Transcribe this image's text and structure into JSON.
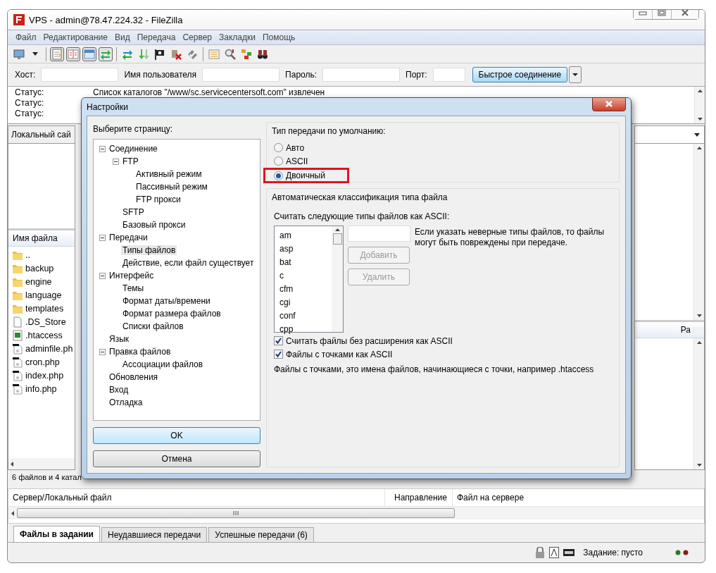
{
  "window": {
    "title": "VPS - admin@78.47.224.32 - FileZilla"
  },
  "menu": [
    "Файл",
    "Редактирование",
    "Вид",
    "Передача",
    "Сервер",
    "Закладки",
    "Помощь"
  ],
  "toolbar": [
    {
      "kind": "monitor"
    },
    {
      "kind": "caret"
    },
    {
      "kind": "sep"
    },
    {
      "kind": "notepad",
      "on": true
    },
    {
      "kind": "panel",
      "on": true
    },
    {
      "kind": "window",
      "on": true
    },
    {
      "kind": "arrows",
      "on": true
    },
    {
      "kind": "sep"
    },
    {
      "kind": "sync"
    },
    {
      "kind": "down"
    },
    {
      "kind": "flag"
    },
    {
      "kind": "cross"
    },
    {
      "kind": "check"
    },
    {
      "kind": "sep"
    },
    {
      "kind": "list"
    },
    {
      "kind": "magnifier"
    },
    {
      "kind": "tree"
    },
    {
      "kind": "binoculars"
    }
  ],
  "quickconnect": {
    "host_label": "Хост:",
    "user_label": "Имя пользователя",
    "password_label": "Пароль:",
    "port_label": "Порт:",
    "button": "Быстрое соединение"
  },
  "log": [
    {
      "label": "Статус:",
      "message": "Список каталогов \"/www/sc.servicecentersoft.com\" извлечен"
    },
    {
      "label": "Статус:"
    },
    {
      "label": "Статус:"
    }
  ],
  "local_site": {
    "label": "Локальный сай"
  },
  "local_files": {
    "column": "Имя файла",
    "rows": [
      {
        "name": "..",
        "kind": "folder"
      },
      {
        "name": "backup",
        "kind": "folder"
      },
      {
        "name": "engine",
        "kind": "folder"
      },
      {
        "name": "language",
        "kind": "folder"
      },
      {
        "name": "templates",
        "kind": "folder"
      },
      {
        "name": ".DS_Store",
        "kind": "file"
      },
      {
        "name": ".htaccess",
        "kind": "config"
      },
      {
        "name": "adminfile.ph",
        "kind": "script"
      },
      {
        "name": "cron.php",
        "kind": "script"
      },
      {
        "name": "index.php",
        "kind": "script"
      },
      {
        "name": "info.php",
        "kind": "script"
      }
    ]
  },
  "remote_files": {
    "column_1": "Ра"
  },
  "local_status": "6 файлов и 4 катал",
  "queue": {
    "columns": [
      "Сервер/Локальный файл",
      "Направление",
      "Файл на сервере"
    ]
  },
  "tabs": [
    {
      "label": "Файлы в задании",
      "selected": true
    },
    {
      "label": "Неудавшиеся передачи",
      "selected": false
    },
    {
      "label": "Успешные передачи (6)",
      "selected": false
    }
  ],
  "status_bar": {
    "queue": "Задание: пусто"
  },
  "dialog": {
    "title": "Настройки",
    "page_label": "Выберите страницу:",
    "tree": [
      {
        "label": "Соединение",
        "expanded": true,
        "selected": false,
        "children": [
          {
            "label": "FTP",
            "expanded": true,
            "selected": false,
            "children": [
              {
                "label": "Активный режим",
                "selected": false
              },
              {
                "label": "Пассивный режим",
                "selected": false
              },
              {
                "label": "FTP прокси",
                "selected": false
              }
            ]
          },
          {
            "label": "SFTP",
            "selected": false
          },
          {
            "label": "Базовый прокси",
            "selected": false
          }
        ]
      },
      {
        "label": "Передачи",
        "expanded": true,
        "selected": false,
        "children": [
          {
            "label": "Типы файлов",
            "selected": true
          },
          {
            "label": "Действие, если файл существует",
            "selected": false
          }
        ]
      },
      {
        "label": "Интерфейс",
        "expanded": true,
        "selected": false,
        "children": [
          {
            "label": "Темы",
            "selected": false
          },
          {
            "label": "Формат даты/времени",
            "selected": false
          },
          {
            "label": "Формат размера файлов",
            "selected": false
          },
          {
            "label": "Списки файлов",
            "selected": false
          }
        ]
      },
      {
        "label": "Язык",
        "selected": false
      },
      {
        "label": "Правка файлов",
        "expanded": true,
        "selected": false,
        "children": [
          {
            "label": "Ассоциации файлов",
            "selected": false
          }
        ]
      },
      {
        "label": "Обновления",
        "selected": false
      },
      {
        "label": "Вход",
        "selected": false
      },
      {
        "label": "Отладка",
        "selected": false
      }
    ],
    "ok": "OK",
    "cancel": "Отмена",
    "transfer_type": {
      "legend": "Тип передачи по умолчанию:",
      "options": [
        {
          "label": "Авто",
          "selected": false
        },
        {
          "label": "ASCII",
          "selected": false
        },
        {
          "label": "Двоичный",
          "selected": true,
          "highlighted": true
        }
      ]
    },
    "classification": {
      "legend": "Автоматическая классификация типа файла",
      "list_label": "Считать следующие типы файлов как ASCII:",
      "extensions": [
        "am",
        "asp",
        "bat",
        "c",
        "cfm",
        "cgi",
        "conf",
        "cpp"
      ],
      "hint": "Если указать неверные типы файлов, то файлы могут быть повреждены при передаче.",
      "add": {
        "label": "Добавить",
        "disabled": true
      },
      "remove": {
        "label": "Удалить",
        "disabled": true
      },
      "checkboxes": [
        {
          "label": "Считать файлы без расширения как ASCII",
          "checked": true
        },
        {
          "label": "Файлы с точками как ASCII",
          "checked": true
        }
      ],
      "note": "Файлы с точками, это имена файлов, начинающиеся с точки, например .htaccess"
    }
  }
}
